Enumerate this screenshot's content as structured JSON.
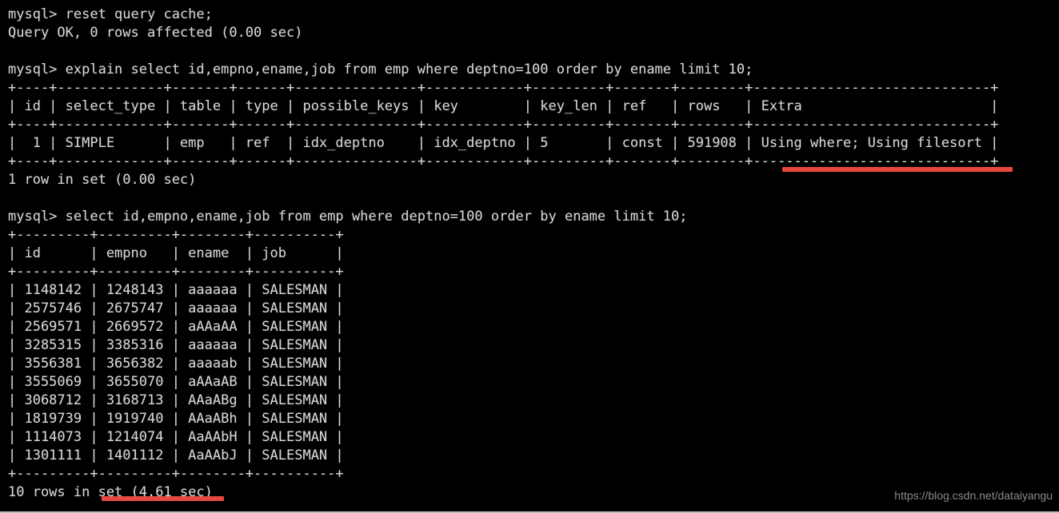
{
  "terminal": {
    "prompt": "mysql> ",
    "background_color": "#000000",
    "text_color": "#d6d6d6",
    "highlight_color": "#e8493f",
    "lines": [
      "mysql> reset query cache;",
      "Query OK, 0 rows affected (0.00 sec)",
      "",
      "mysql> explain select id,empno,ename,job from emp where deptno=100 order by ename limit 10;",
      "+----+-------------+-------+------+---------------+------------+---------+-------+--------+-----------------------------+",
      "| id | select_type | table | type | possible_keys | key        | key_len | ref   | rows   | Extra                       |",
      "+----+-------------+-------+------+---------------+------------+---------+-------+--------+-----------------------------+",
      "|  1 | SIMPLE      | emp   | ref  | idx_deptno    | idx_deptno | 5       | const | 591908 | Using where; Using filesort |",
      "+----+-------------+-------+------+---------------+------------+---------+-------+--------+-----------------------------+",
      "1 row in set (0.00 sec)",
      "",
      "mysql> select id,empno,ename,job from emp where deptno=100 order by ename limit 10;",
      "+---------+---------+--------+----------+",
      "| id      | empno   | ename  | job      |",
      "+---------+---------+--------+----------+",
      "| 1148142 | 1248143 | aaaaaa | SALESMAN |",
      "| 2575746 | 2675747 | aaaaaa | SALESMAN |",
      "| 2569571 | 2669572 | aAAaAA | SALESMAN |",
      "| 3285315 | 3385316 | aaaaaa | SALESMAN |",
      "| 3556381 | 3656382 | aaaaab | SALESMAN |",
      "| 3555069 | 3655070 | aAAaAB | SALESMAN |",
      "| 3068712 | 3168713 | AAaABg | SALESMAN |",
      "| 1819739 | 1919740 | AAaABh | SALESMAN |",
      "| 1114073 | 1214074 | AaAAbH | SALESMAN |",
      "| 1301111 | 1401112 | AaAAbJ | SALESMAN |",
      "+---------+---------+--------+----------+",
      "10 rows in set (4.61 sec)"
    ]
  },
  "commands": {
    "reset_cache": "reset query cache;",
    "reset_cache_result": "Query OK, 0 rows affected (0.00 sec)",
    "explain_query": "explain select id,empno,ename,job from emp where deptno=100 order by ename limit 10;",
    "explain_result_status": "1 row in set (0.00 sec)",
    "select_query": "select id,empno,ename,job from emp where deptno=100 order by ename limit 10;",
    "select_result_status": "10 rows in set (4.61 sec)"
  },
  "explain_table": {
    "headers": [
      "id",
      "select_type",
      "table",
      "type",
      "possible_keys",
      "key",
      "key_len",
      "ref",
      "rows",
      "Extra"
    ],
    "rows": [
      [
        "1",
        "SIMPLE",
        "emp",
        "ref",
        "idx_deptno",
        "idx_deptno",
        "5",
        "const",
        "591908",
        "Using where; Using filesort"
      ]
    ]
  },
  "result_table": {
    "headers": [
      "id",
      "empno",
      "ename",
      "job"
    ],
    "rows": [
      [
        "1148142",
        "1248143",
        "aaaaaa",
        "SALESMAN"
      ],
      [
        "2575746",
        "2675747",
        "aaaaaa",
        "SALESMAN"
      ],
      [
        "2569571",
        "2669572",
        "aAAaAA",
        "SALESMAN"
      ],
      [
        "3285315",
        "3385316",
        "aaaaaa",
        "SALESMAN"
      ],
      [
        "3556381",
        "3656382",
        "aaaaab",
        "SALESMAN"
      ],
      [
        "3555069",
        "3655070",
        "aAAaAB",
        "SALESMAN"
      ],
      [
        "3068712",
        "3168713",
        "AAaABg",
        "SALESMAN"
      ],
      [
        "1819739",
        "1919740",
        "AAaABh",
        "SALESMAN"
      ],
      [
        "1114073",
        "1214074",
        "AaAAbH",
        "SALESMAN"
      ],
      [
        "1301111",
        "1401112",
        "AaAAbJ",
        "SALESMAN"
      ]
    ]
  },
  "annotations": {
    "extra_underline_label": "Using where; Using filesort",
    "time_underline_label": "set (4.61 sec)"
  },
  "watermark": {
    "text": "https://blog.csdn.net/dataiyangu"
  }
}
